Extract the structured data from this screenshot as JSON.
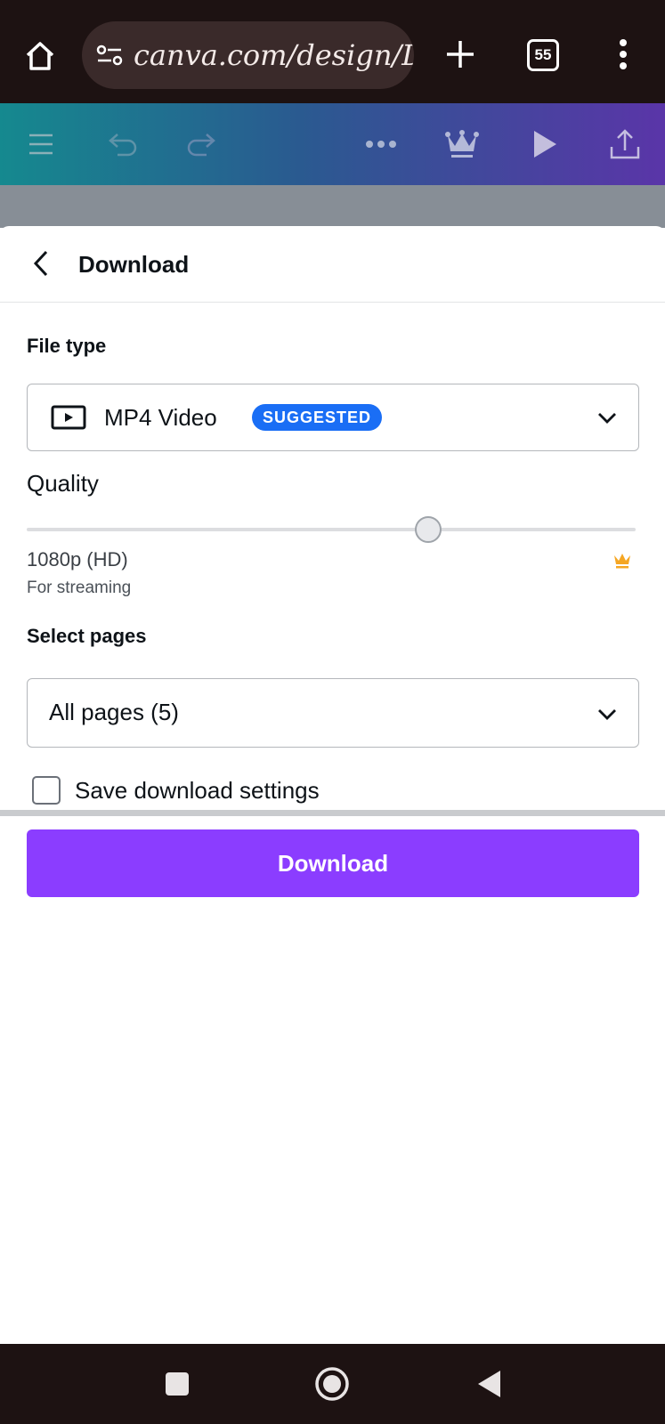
{
  "browser": {
    "url": "canva.com/design/D",
    "tab_count": "55"
  },
  "panel": {
    "title": "Download",
    "file_type": {
      "label": "File type",
      "value": "MP4 Video",
      "badge": "SUGGESTED"
    },
    "quality": {
      "label": "Quality",
      "value": "1080p (HD)",
      "note": "For streaming",
      "level": 0.66
    },
    "pages": {
      "label": "Select pages",
      "value": "All pages (5)"
    },
    "save_settings": {
      "label": "Save download settings",
      "checked": false
    },
    "download_button": "Download"
  },
  "colors": {
    "accent": "#8b3dff",
    "badge": "#1a6ef5",
    "crown": "#f5a623",
    "chrome": "#1d1212"
  }
}
